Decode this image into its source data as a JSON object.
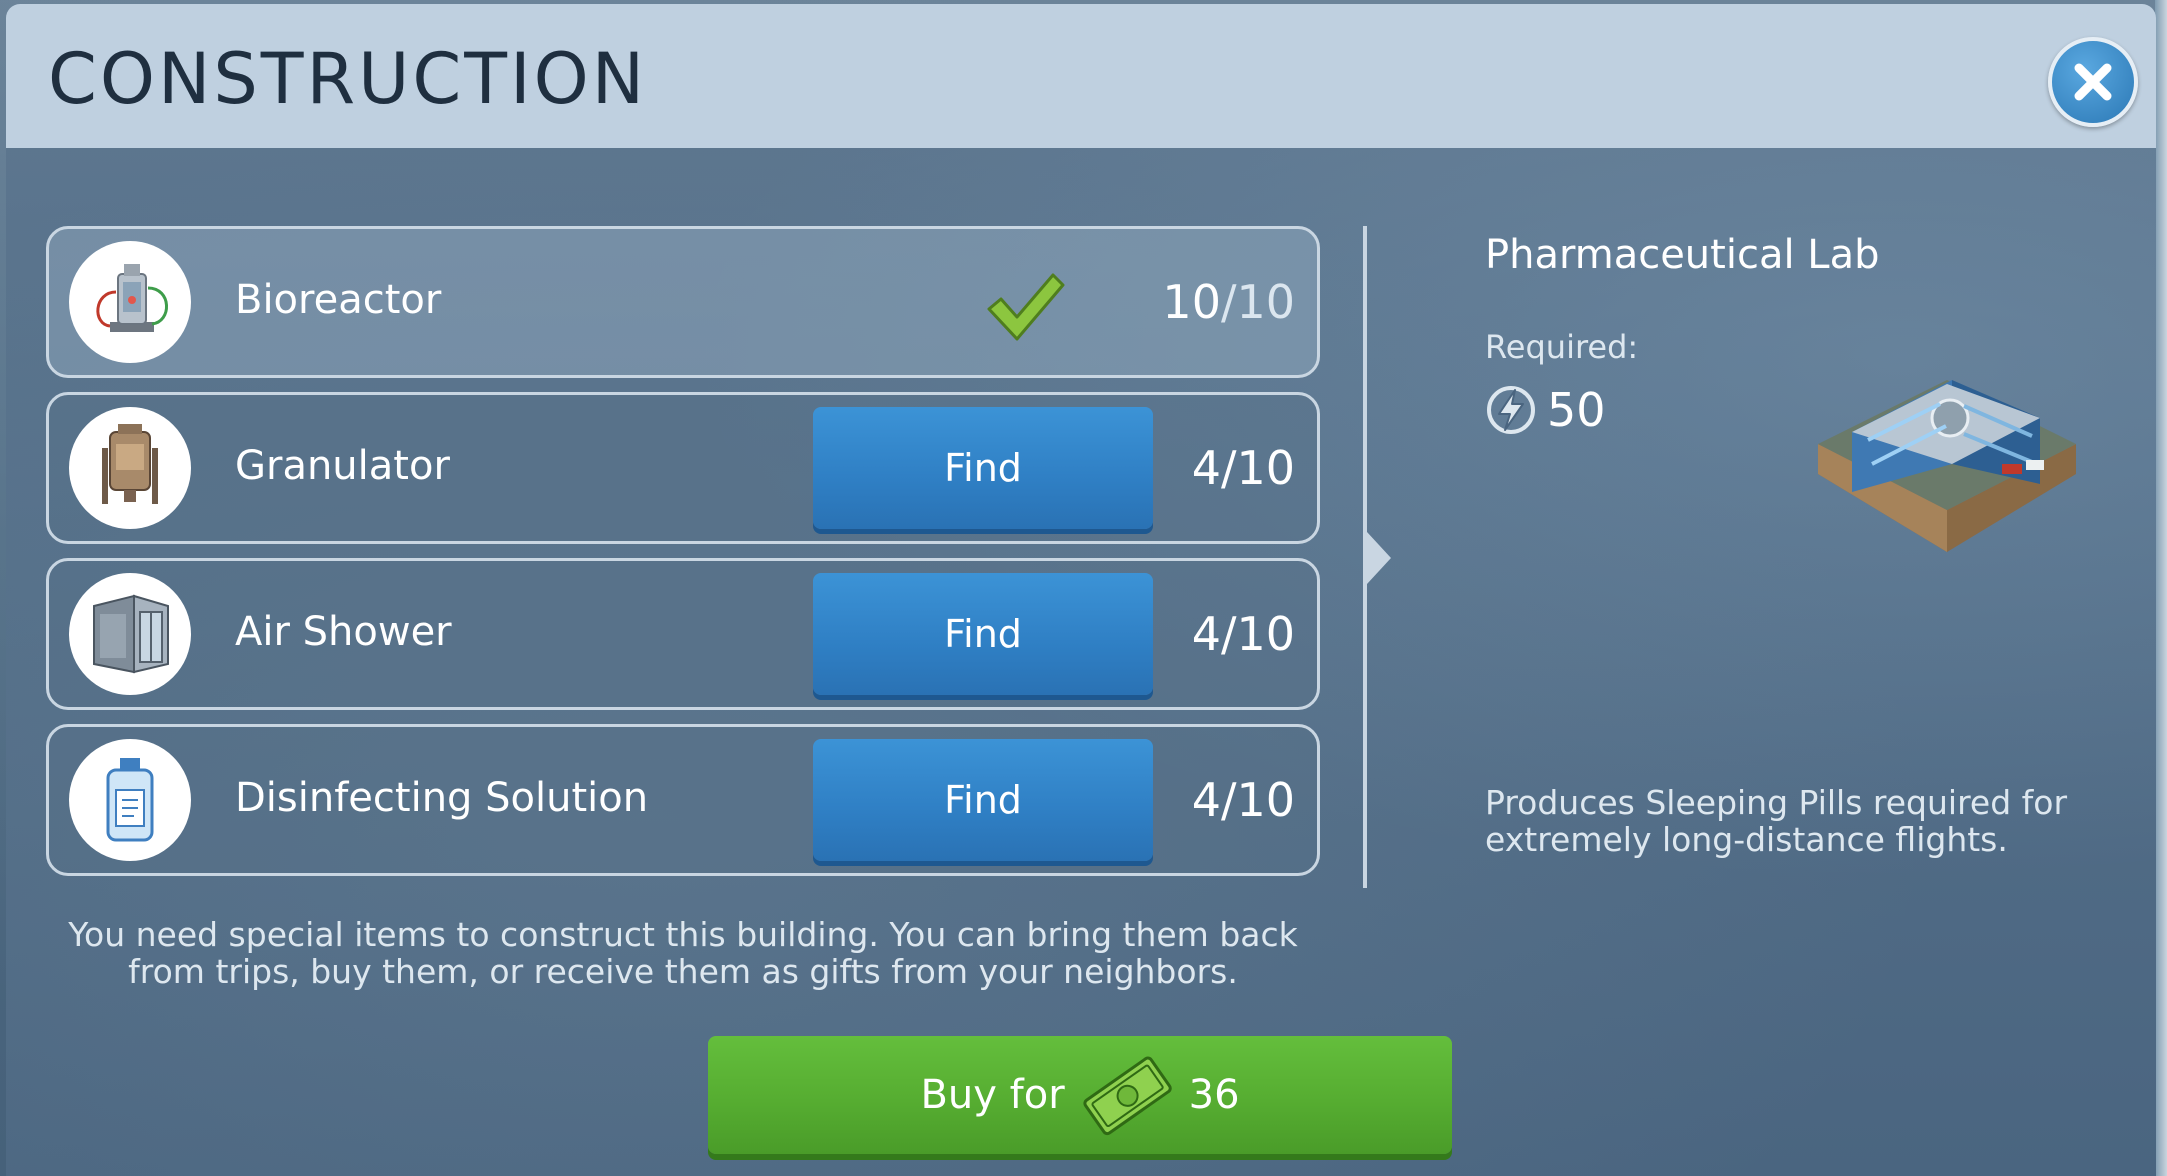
{
  "dialog": {
    "title": "CONSTRUCTION",
    "close_icon": "close-icon"
  },
  "items": [
    {
      "name": "Bioreactor",
      "have": "10",
      "need": "/10",
      "status": "complete",
      "icon": "bioreactor-icon"
    },
    {
      "name": "Granulator",
      "have": "4",
      "need": "/10",
      "action": "Find",
      "icon": "granulator-icon"
    },
    {
      "name": "Air Shower",
      "have": "4",
      "need": "/10",
      "action": "Find",
      "icon": "air-shower-icon"
    },
    {
      "name": "Disinfecting Solution",
      "have": "4",
      "need": "/10",
      "action": "Find",
      "icon": "disinfecting-solution-icon"
    }
  ],
  "building": {
    "name": "Pharmaceutical Lab",
    "required_label": "Required:",
    "required_value": "50",
    "required_icon": "energy-icon",
    "description": "Produces Sleeping Pills required for extremely long-distance flights."
  },
  "footer": {
    "note": "You need special items to construct this building. You can bring them back from trips, buy them, or receive them as gifts from your neighbors.",
    "buy_label": "Buy for",
    "buy_price": "36",
    "currency_icon": "cash-icon"
  },
  "colors": {
    "header": "#bfd0e0",
    "find_button": "#2f7fc4",
    "buy_button": "#56ad31",
    "check": "#8cc63f"
  }
}
